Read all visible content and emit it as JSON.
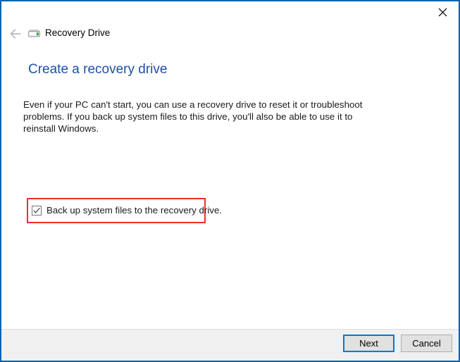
{
  "window": {
    "app_title": "Recovery Drive",
    "app_icon": "recovery-drive-icon",
    "back_icon": "back-arrow-icon",
    "close_icon": "close-icon",
    "frame_color": "#0063b1"
  },
  "page": {
    "heading": "Create a recovery drive",
    "heading_color": "#1f4fa8",
    "intro": "Even if your PC can't start, you can use a recovery drive to reset it or troubleshoot problems. If you back up system files to this drive, you'll also be able to use it to reinstall Windows."
  },
  "options": {
    "backup_system_files": {
      "label": "Back up system files to the recovery drive.",
      "checked": true,
      "check_icon": "checkmark-icon"
    }
  },
  "annotation": {
    "highlight_color": "#ee3124",
    "highlight_target": "backup-system-files-checkbox"
  },
  "footer": {
    "next_label": "Next",
    "cancel_label": "Cancel",
    "default_button_color": "#0078d7"
  }
}
